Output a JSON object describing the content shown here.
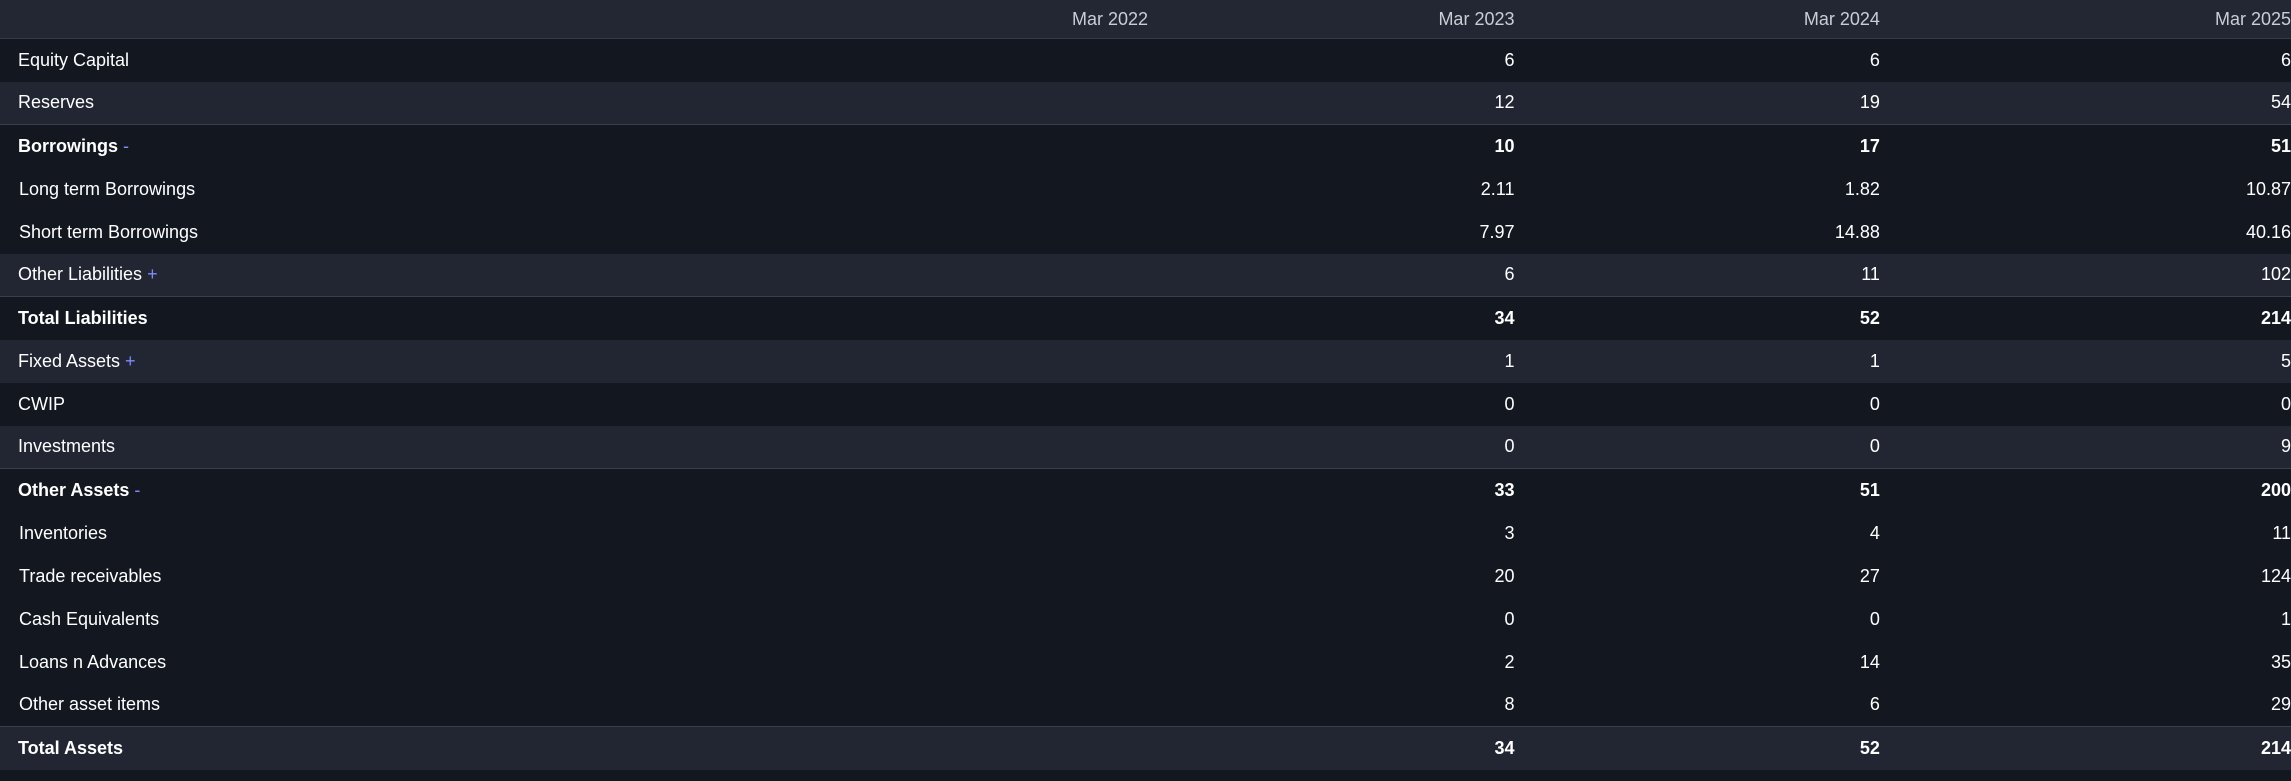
{
  "header": {
    "columns": [
      "Mar 2022",
      "Mar 2023",
      "Mar 2024",
      "Mar 2025"
    ]
  },
  "rows": [
    {
      "label": "Equity Capital",
      "toggle": "",
      "values": [
        "",
        "6",
        "6",
        "6"
      ]
    },
    {
      "label": "Reserves",
      "toggle": "",
      "values": [
        "",
        "12",
        "19",
        "54"
      ]
    },
    {
      "label": "Borrowings",
      "toggle": "-",
      "values": [
        "",
        "10",
        "17",
        "51"
      ]
    },
    {
      "label": "Long term Borrowings",
      "toggle": "",
      "values": [
        "",
        "2.11",
        "1.82",
        "10.87"
      ]
    },
    {
      "label": "Short term Borrowings",
      "toggle": "",
      "values": [
        "",
        "7.97",
        "14.88",
        "40.16"
      ]
    },
    {
      "label": "Other Liabilities",
      "toggle": "+",
      "values": [
        "",
        "6",
        "11",
        "102"
      ]
    },
    {
      "label": "Total Liabilities",
      "toggle": "",
      "values": [
        "",
        "34",
        "52",
        "214"
      ]
    },
    {
      "label": "Fixed Assets",
      "toggle": "+",
      "values": [
        "",
        "1",
        "1",
        "5"
      ]
    },
    {
      "label": "CWIP",
      "toggle": "",
      "values": [
        "",
        "0",
        "0",
        "0"
      ]
    },
    {
      "label": "Investments",
      "toggle": "",
      "values": [
        "",
        "0",
        "0",
        "9"
      ]
    },
    {
      "label": "Other Assets",
      "toggle": "-",
      "values": [
        "",
        "33",
        "51",
        "200"
      ]
    },
    {
      "label": "Inventories",
      "toggle": "",
      "values": [
        "",
        "3",
        "4",
        "11"
      ]
    },
    {
      "label": "Trade receivables",
      "toggle": "",
      "values": [
        "",
        "20",
        "27",
        "124"
      ]
    },
    {
      "label": "Cash Equivalents",
      "toggle": "",
      "values": [
        "",
        "0",
        "0",
        "1"
      ]
    },
    {
      "label": "Loans n Advances",
      "toggle": "",
      "values": [
        "",
        "2",
        "14",
        "35"
      ]
    },
    {
      "label": "Other asset items",
      "toggle": "",
      "values": [
        "",
        "8",
        "6",
        "29"
      ]
    },
    {
      "label": "Total Assets",
      "toggle": "",
      "values": [
        "",
        "34",
        "52",
        "214"
      ]
    }
  ]
}
